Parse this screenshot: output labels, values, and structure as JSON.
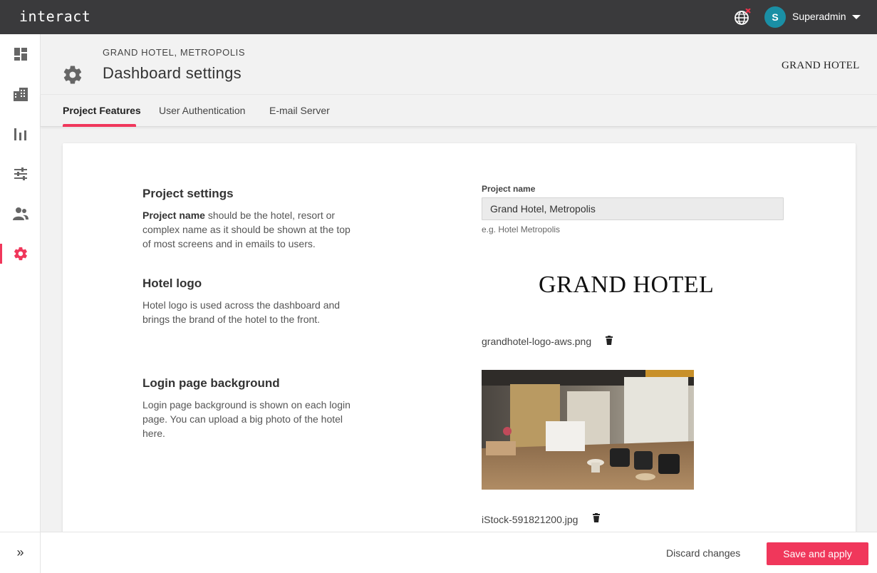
{
  "app": {
    "brand": "interact"
  },
  "topbar": {
    "username": "Superadmin",
    "avatar_initial": "S"
  },
  "sidebar": {
    "items": [
      {
        "name": "dashboard",
        "icon": "dashboard-icon",
        "active": false
      },
      {
        "name": "buildings",
        "icon": "building-icon",
        "active": false
      },
      {
        "name": "analytics",
        "icon": "bar-chart-icon",
        "active": false
      },
      {
        "name": "controls",
        "icon": "sliders-icon",
        "active": false
      },
      {
        "name": "users",
        "icon": "people-icon",
        "active": false
      },
      {
        "name": "settings",
        "icon": "gear-icon",
        "active": true
      }
    ],
    "expand_label": "»"
  },
  "header": {
    "breadcrumb": "GRAND HOTEL, METROPOLIS",
    "title": "Dashboard settings",
    "logo_text": "GRAND HOTEL"
  },
  "tabs": [
    {
      "label": "Project Features",
      "active": true
    },
    {
      "label": "User Authentication",
      "active": false
    },
    {
      "label": "E-mail Server",
      "active": false
    }
  ],
  "sections": {
    "project": {
      "title": "Project settings",
      "desc_bold": "Project name",
      "desc_rest": " should be the hotel, resort or complex name as it should be shown at the top of most screens and in emails to users.",
      "field_label": "Project name",
      "field_value": "Grand Hotel, Metropolis",
      "field_hint": "e.g. Hotel Metropolis"
    },
    "logo": {
      "title": "Hotel logo",
      "desc": "Hotel logo is used across the dashboard and brings the brand of the hotel to the front.",
      "logo_text": "GRAND HOTEL",
      "filename": "grandhotel-logo-aws.png"
    },
    "background": {
      "title": "Login page background",
      "desc": "Login page background is shown on each login page. You can upload a big photo of the hotel here.",
      "filename": "iStock-591821200.jpg"
    }
  },
  "footer": {
    "discard_label": "Discard changes",
    "save_label": "Save and apply"
  },
  "colors": {
    "accent": "#f0375b",
    "topbar": "#3a3a3c",
    "avatar": "#1a8fa5"
  }
}
